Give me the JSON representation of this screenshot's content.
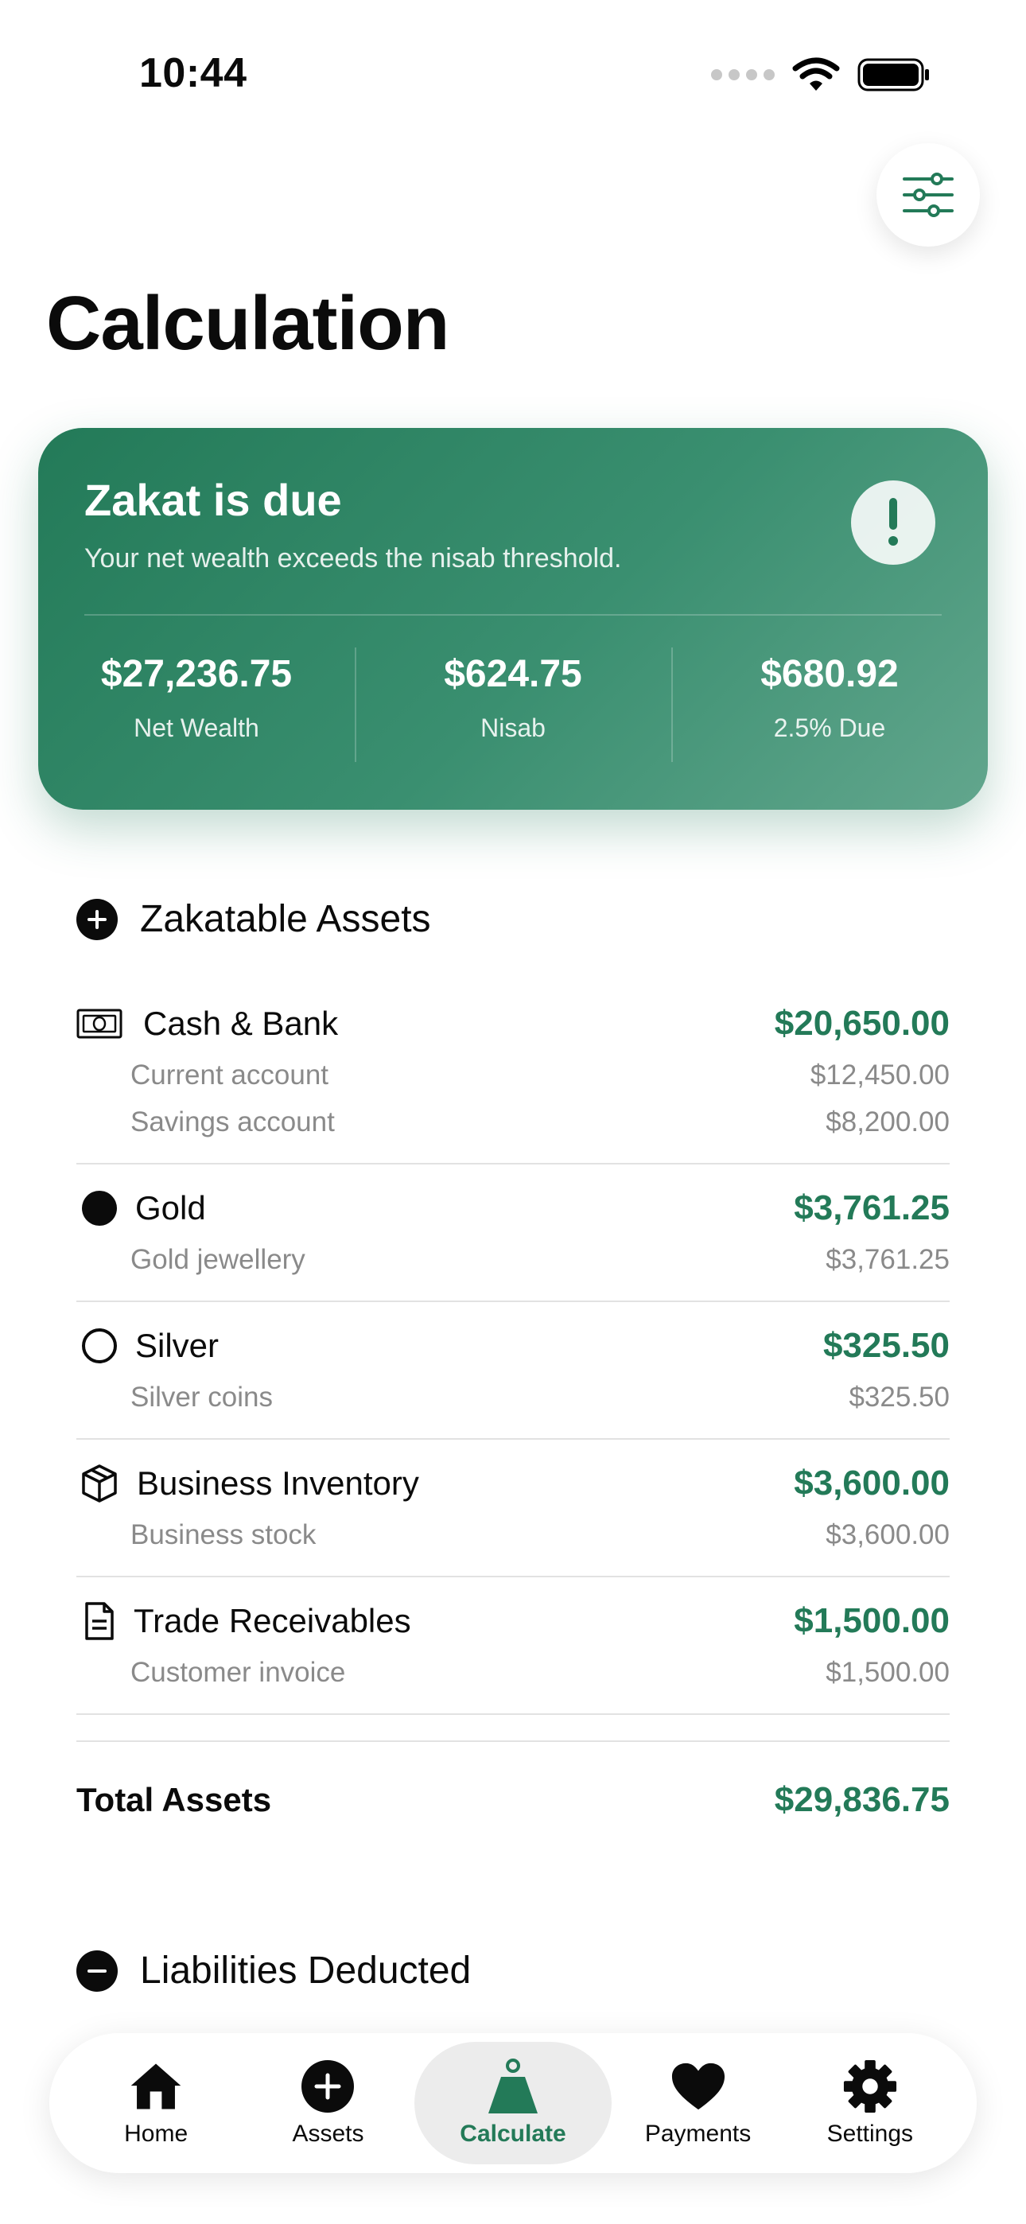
{
  "status_bar": {
    "time": "10:44"
  },
  "page": {
    "title": "Calculation"
  },
  "summary": {
    "title": "Zakat is due",
    "subtitle": "Your net wealth exceeds the nisab threshold.",
    "alert_icon": "exclamation-icon",
    "stats": [
      {
        "value": "$27,236.75",
        "label": "Net Wealth"
      },
      {
        "value": "$624.75",
        "label": "Nisab"
      },
      {
        "value": "$680.92",
        "label": "2.5% Due"
      }
    ]
  },
  "zakatable": {
    "title": "Zakatable Assets",
    "groups": [
      {
        "name": "Cash & Bank",
        "icon": "banknote-icon",
        "total": "$20,650.00",
        "items": [
          {
            "label": "Current account",
            "value": "$12,450.00"
          },
          {
            "label": "Savings account",
            "value": "$8,200.00"
          }
        ]
      },
      {
        "name": "Gold",
        "icon": "filled-circle-icon",
        "total": "$3,761.25",
        "items": [
          {
            "label": "Gold jewellery",
            "value": "$3,761.25"
          }
        ]
      },
      {
        "name": "Silver",
        "icon": "outline-circle-icon",
        "total": "$325.50",
        "items": [
          {
            "label": "Silver coins",
            "value": "$325.50"
          }
        ]
      },
      {
        "name": "Business Inventory",
        "icon": "box-icon",
        "total": "$3,600.00",
        "items": [
          {
            "label": "Business stock",
            "value": "$3,600.00"
          }
        ]
      },
      {
        "name": "Trade Receivables",
        "icon": "document-icon",
        "total": "$1,500.00",
        "items": [
          {
            "label": "Customer invoice",
            "value": "$1,500.00"
          }
        ]
      }
    ],
    "total_label": "Total Assets",
    "total_value": "$29,836.75"
  },
  "liabilities": {
    "title": "Liabilities Deducted"
  },
  "tabs": [
    {
      "label": "Home",
      "icon": "home-icon"
    },
    {
      "label": "Assets",
      "icon": "plus-circle-icon"
    },
    {
      "label": "Calculate",
      "icon": "weight-icon",
      "active": true
    },
    {
      "label": "Payments",
      "icon": "heart-icon"
    },
    {
      "label": "Settings",
      "icon": "gear-icon"
    }
  ],
  "colors": {
    "accent": "#237a58",
    "muted": "#8a8a8a"
  }
}
